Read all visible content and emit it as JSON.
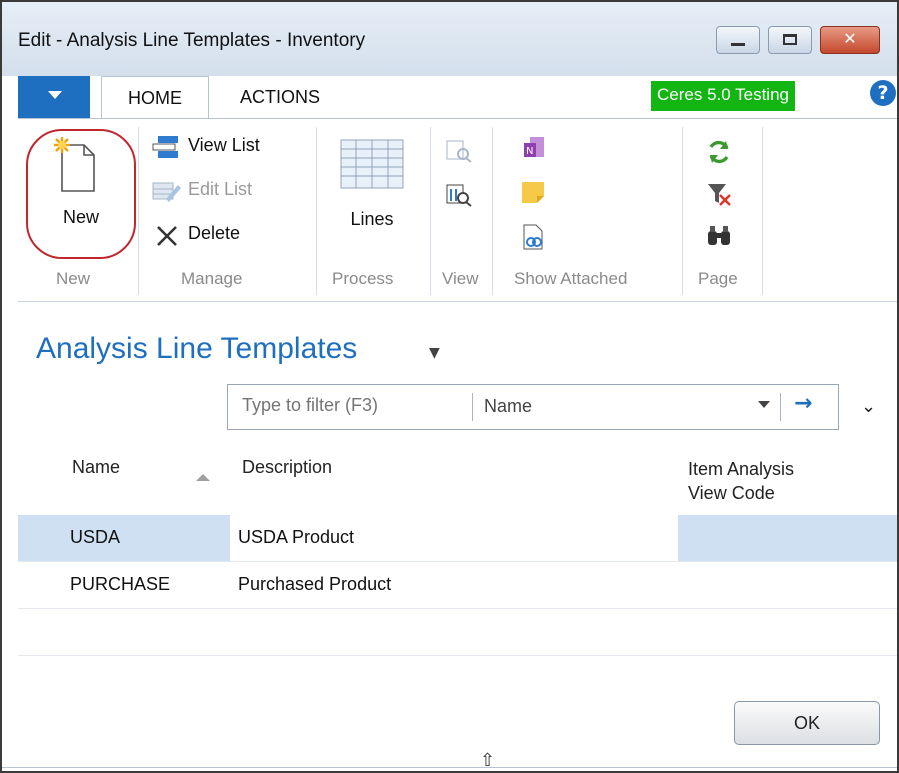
{
  "window": {
    "title": "Edit - Analysis Line Templates - Inventory",
    "minimize_glyph": "",
    "close_glyph": "✕"
  },
  "ribbon": {
    "tabs": [
      {
        "label": "HOME",
        "active": true
      },
      {
        "label": "ACTIONS",
        "active": false
      }
    ],
    "environment_badge": "Ceres 5.0 Testing",
    "help_glyph": "?",
    "groups": {
      "new": {
        "label": "New",
        "new_button": "New"
      },
      "manage": {
        "label": "Manage",
        "view_list": "View List",
        "edit_list": "Edit List",
        "delete": "Delete"
      },
      "process": {
        "label": "Process",
        "lines": "Lines"
      },
      "view": {
        "label": "View"
      },
      "show_attached": {
        "label": "Show Attached"
      },
      "page": {
        "label": "Page"
      }
    },
    "icons": [
      "new-document-icon",
      "view-list-icon",
      "edit-list-icon",
      "delete-icon",
      "lines-grid-icon",
      "view-icon",
      "onenote-icon",
      "note-icon",
      "link-icon",
      "refresh-icon",
      "clear-filter-icon",
      "find-icon"
    ],
    "accent_color": "#1f6fc1",
    "badge_color": "#13b513"
  },
  "page": {
    "title": "Analysis Line Templates",
    "filter": {
      "placeholder": "Type to filter (F3)",
      "field": "Name"
    },
    "columns": {
      "name": "Name",
      "description": "Description",
      "view_code_line1": "Item Analysis",
      "view_code_line2": "View Code"
    },
    "rows": [
      {
        "name": "USDA",
        "description": "USDA Product",
        "view_code": "",
        "selected": true
      },
      {
        "name": "PURCHASE",
        "description": "Purchased Product",
        "view_code": "",
        "selected": false
      }
    ],
    "ok_button": "OK"
  }
}
